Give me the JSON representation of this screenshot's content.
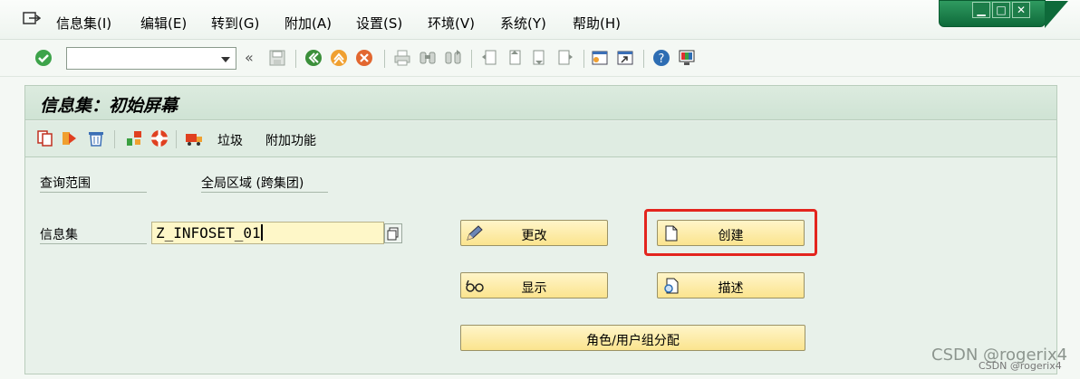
{
  "menubar": {
    "items": [
      "信息集(I)",
      "编辑(E)",
      "转到(G)",
      "附加(A)",
      "设置(S)",
      "环境(V)",
      "系统(Y)",
      "帮助(H)"
    ]
  },
  "toolbar": {
    "command_value": "",
    "icons": [
      "enter-icon",
      "back-icon",
      "save-icon",
      "back-green-icon",
      "exit-icon",
      "cancel-icon",
      "print-icon",
      "find-icon",
      "find-next-icon",
      "first-page-icon",
      "prev-page-icon",
      "next-page-icon",
      "last-page-icon",
      "new-session-icon",
      "shortcut-icon",
      "help-icon",
      "layout-icon"
    ]
  },
  "screen": {
    "title": "信息集：初始屏幕"
  },
  "app_toolbar": {
    "trash": "垃圾",
    "extras": "附加功能"
  },
  "form": {
    "query_area_label": "查询范围",
    "query_area_value": "全局区域 (跨集团)",
    "infoset_label": "信息集",
    "infoset_value": "Z_INFOSET_01"
  },
  "buttons": {
    "change": "更改",
    "create": "创建",
    "display": "显示",
    "describe": "描述",
    "role_assign": "角色/用户组分配"
  },
  "watermark": {
    "main": "CSDN @rogerix4",
    "sub": "CSDN @rogerix4"
  },
  "colors": {
    "button_fill": "#fbe48e",
    "highlight": "#e3251e",
    "field_fill": "#fef7c8",
    "title_bar": "#cfe3d4"
  }
}
